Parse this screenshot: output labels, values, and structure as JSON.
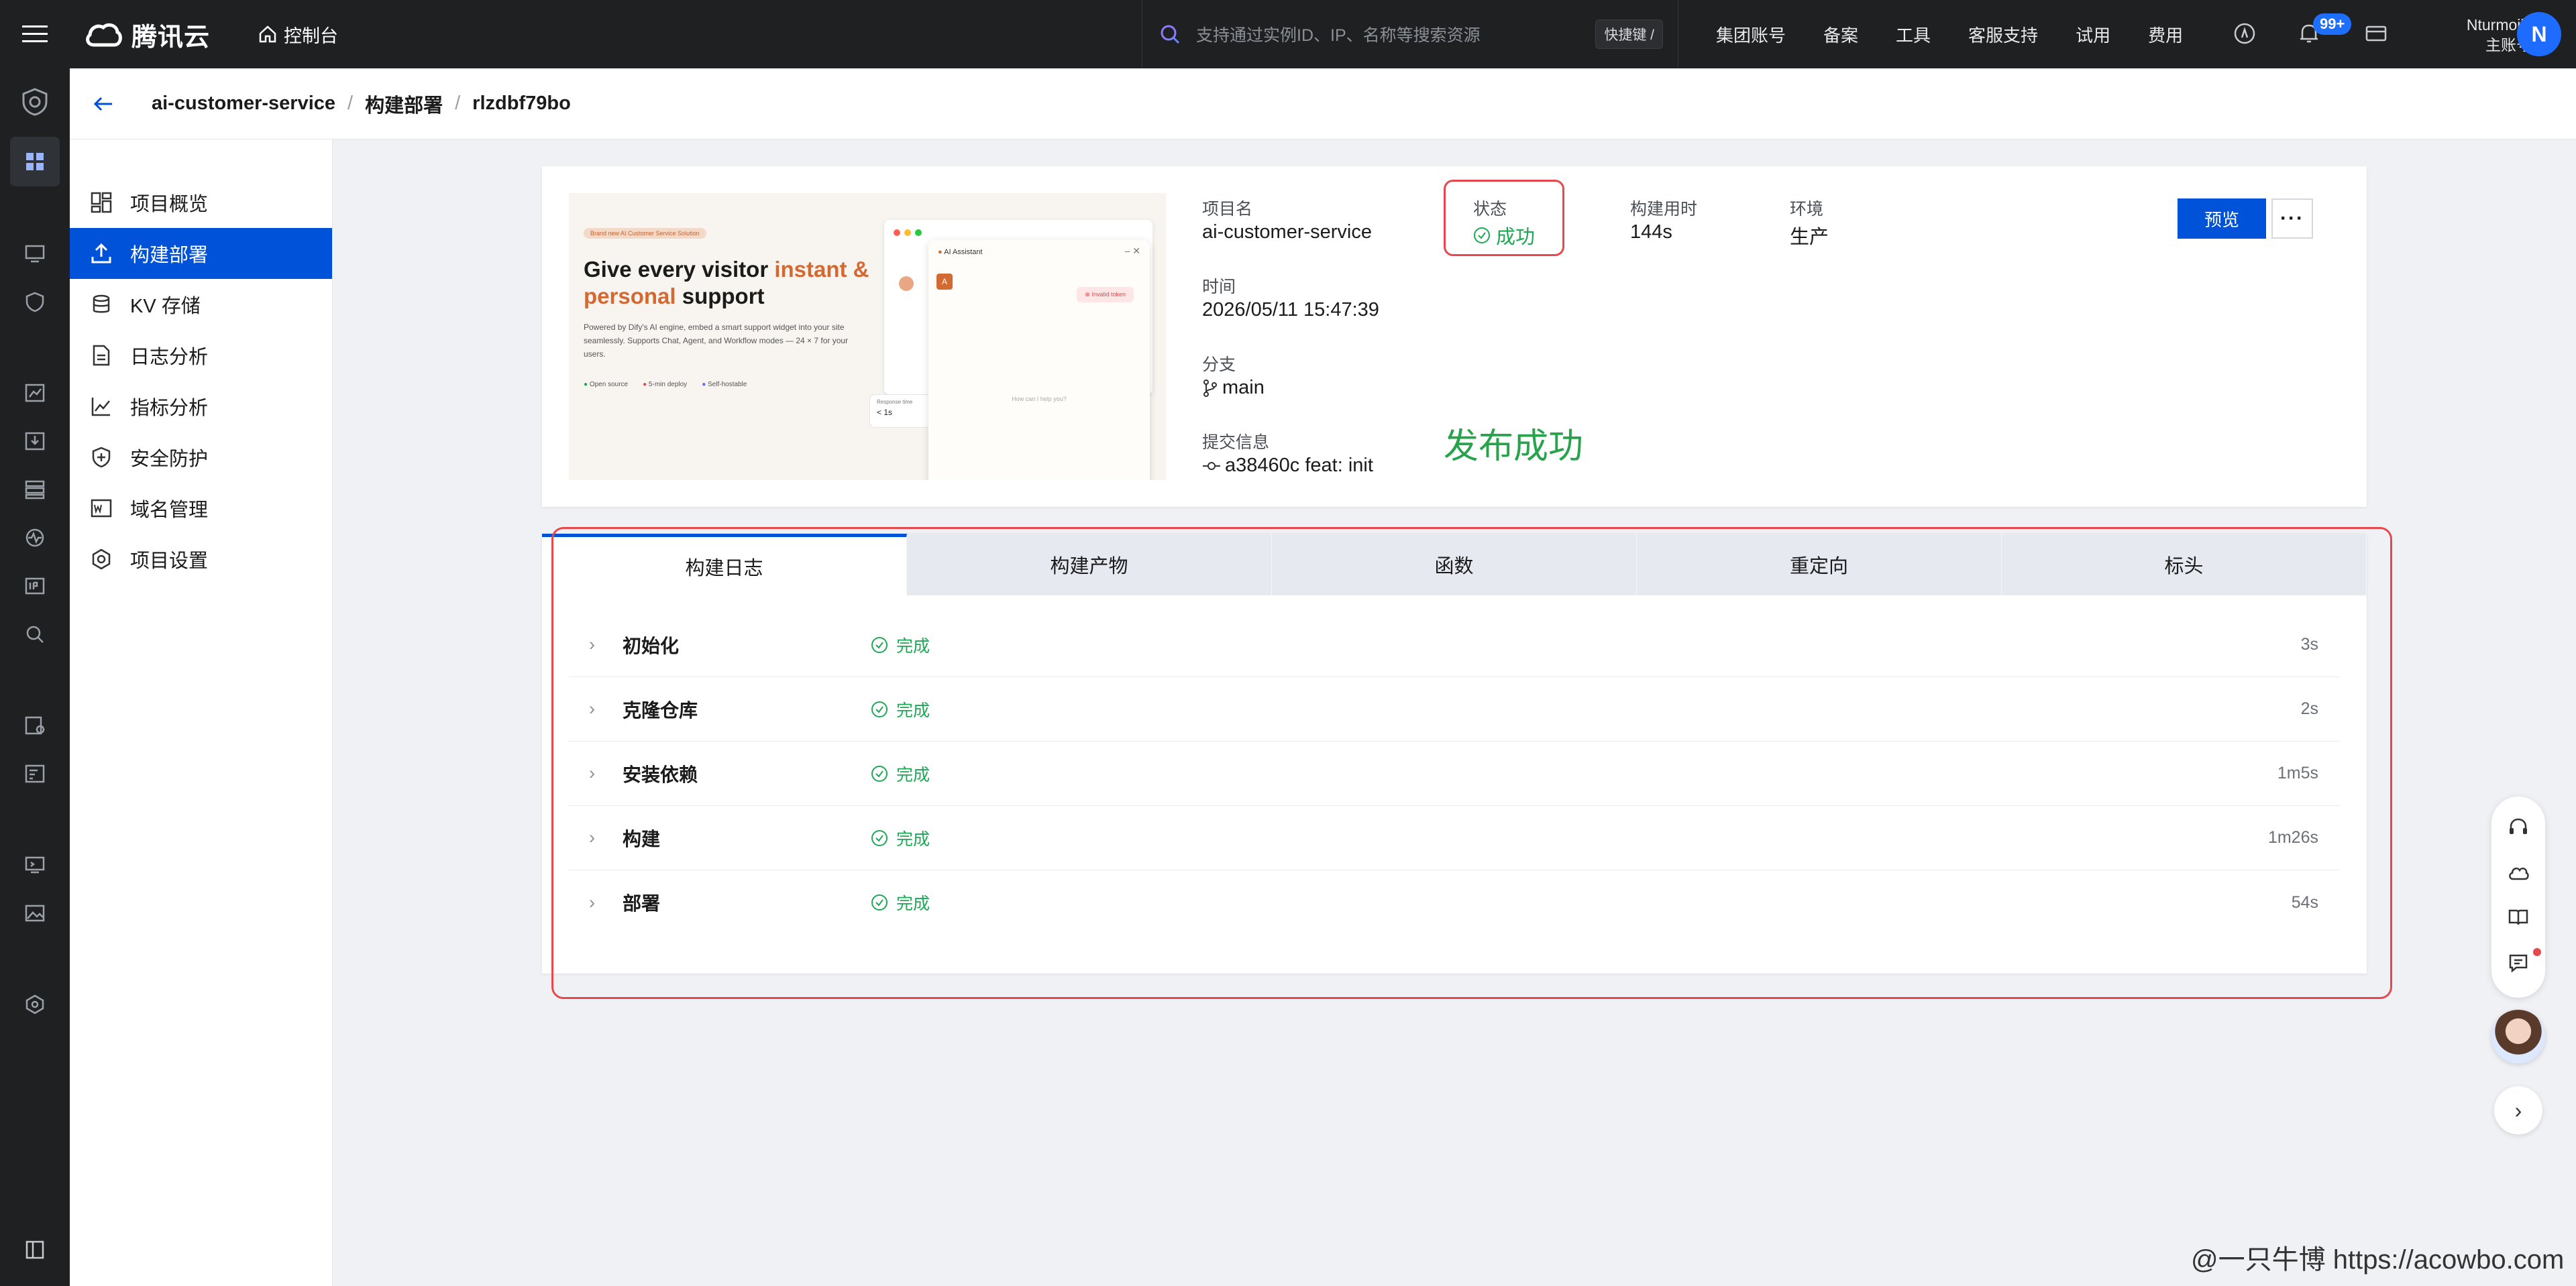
{
  "topbar": {
    "brand": "腾讯云",
    "console": "控制台",
    "search_placeholder": "支持通过实例ID、IP、名称等搜索资源",
    "shortcut": "快捷键 /",
    "nav": [
      "集团账号",
      "备案",
      "工具",
      "客服支持",
      "试用",
      "费用"
    ],
    "badge": "99+",
    "user_name": "Nturmoils",
    "user_role": "主账号",
    "avatar_letter": "N"
  },
  "breadcrumb": {
    "project": "ai-customer-service",
    "section": "构建部署",
    "build_id": "rlzdbf79bo",
    "sep": "/"
  },
  "sidebar": {
    "items": [
      {
        "label": "项目概览",
        "icon": "dashboard-icon"
      },
      {
        "label": "构建部署",
        "icon": "upload-icon",
        "active": true
      },
      {
        "label": "KV 存储",
        "icon": "database-icon"
      },
      {
        "label": "日志分析",
        "icon": "document-icon"
      },
      {
        "label": "指标分析",
        "icon": "line-chart-icon"
      },
      {
        "label": "安全防护",
        "icon": "shield-icon"
      },
      {
        "label": "域名管理",
        "icon": "www-icon"
      },
      {
        "label": "项目设置",
        "icon": "settings-icon"
      }
    ]
  },
  "deploy": {
    "thumb": {
      "tag": "Brand new AI Customer Service Solution",
      "headline_a": "Give every visitor ",
      "headline_b": "instant &",
      "headline_c": "personal",
      "headline_d": " support",
      "body": "Powered by Dify's AI engine, embed a smart support widget into your site seamlessly. Supports Chat, Agent, and Workflow modes — 24 × 7 for your users.",
      "bullets": [
        "Open source",
        "5-min deploy",
        "Self-hostable"
      ],
      "widget_title": "AI Assistant",
      "widget_error": "Invalid token",
      "widget_placeholder": "How can I help you?",
      "response_label": "Response time",
      "response_value": "< 1s"
    },
    "labels": {
      "project_name": "项目名",
      "status": "状态",
      "duration": "构建用时",
      "env": "环境",
      "time": "时间",
      "branch": "分支",
      "commit": "提交信息"
    },
    "values": {
      "project_name": "ai-customer-service",
      "status": "成功",
      "duration": "144s",
      "env": "生产",
      "time": "2026/05/11 15:47:39",
      "branch": "main",
      "commit": "a38460c feat: init"
    },
    "annotation": "发布成功",
    "preview_btn": "预览",
    "more_btn": "···"
  },
  "tabs": [
    "构建日志",
    "构建产物",
    "函数",
    "重定向",
    "标头"
  ],
  "steps": [
    {
      "name": "初始化",
      "status": "完成",
      "time": "3s"
    },
    {
      "name": "克隆仓库",
      "status": "完成",
      "time": "2s"
    },
    {
      "name": "安装依赖",
      "status": "完成",
      "time": "1m5s"
    },
    {
      "name": "构建",
      "status": "完成",
      "time": "1m26s"
    },
    {
      "name": "部署",
      "status": "完成",
      "time": "54s"
    }
  ],
  "watermark": "@一只牛博 https://acowbo.com",
  "colors": {
    "primary": "#0052d9",
    "success": "#1da855",
    "highlight": "#e5484d"
  }
}
